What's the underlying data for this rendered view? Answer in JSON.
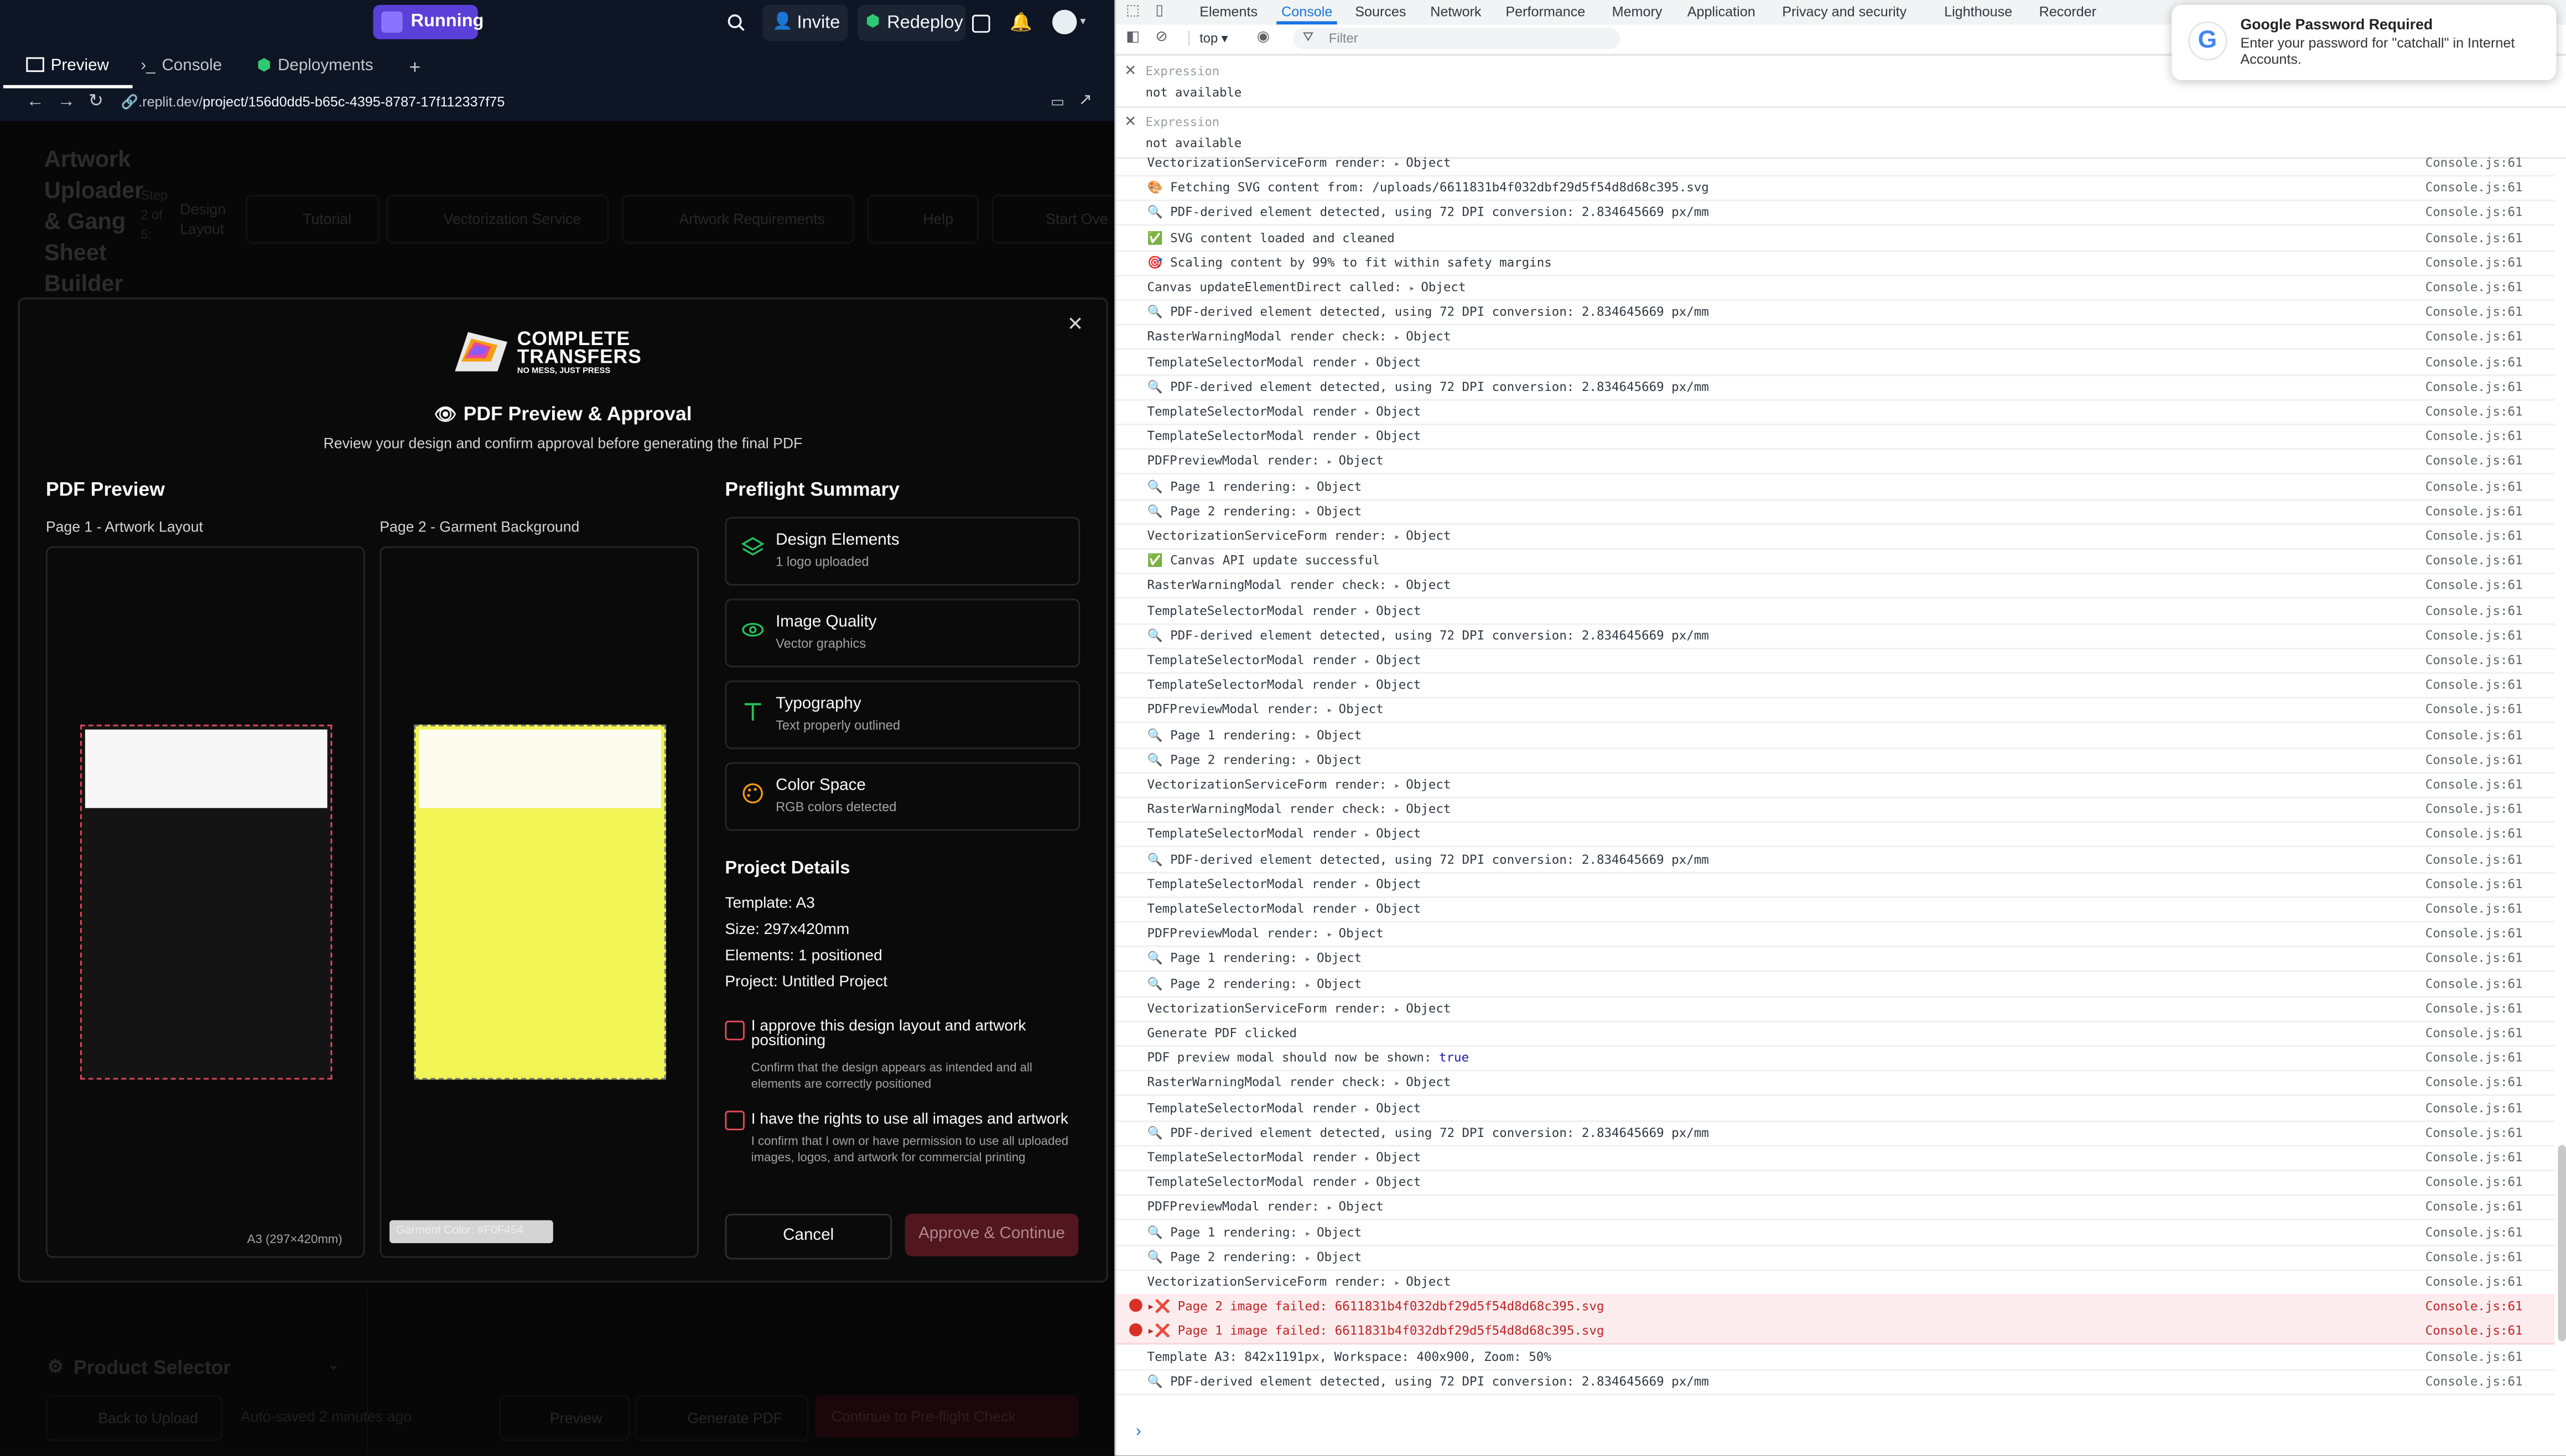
{
  "replit": {
    "status_label": "Running",
    "invite_label": "Invite",
    "redeploy_label": "Redeploy",
    "tabs": [
      {
        "label": "Preview"
      },
      {
        "label": "Console"
      },
      {
        "label": "Deployments"
      }
    ],
    "url_prefix": ".replit.dev/",
    "url_path": "project/156d0dd5-b65c-4395-8787-17f112337f75"
  },
  "app_bg": {
    "title": "Artwork Uploader & Gang Sheet Builder",
    "step": "Step 2 of 5:",
    "step_name": "Design Layout",
    "nav": [
      "Tutorial",
      "Vectorization Service",
      "Artwork Requirements",
      "Help",
      "Start Ove"
    ],
    "product_selector": "Product Selector",
    "back_label": "Back to Upload",
    "autosaved": "Auto-saved 2 minutes ago",
    "preview_label": "Preview",
    "generate_label": "Generate PDF",
    "continue_label": "Continue to Pre-flight Check"
  },
  "modal": {
    "brand_line1": "COMPLETE",
    "brand_line2": "TRANSFERS",
    "brand_tagline": "NO MESS, JUST PRESS",
    "title": "PDF Preview & Approval",
    "subtitle": "Review your design and confirm approval before generating the final PDF",
    "pdf_preview_heading": "PDF Preview",
    "page1_label": "Page 1 - Artwork Layout",
    "page2_label": "Page 2 - Garment Background",
    "page1_size": "A3 (297×420mm)",
    "page2_badge": "Garment Color: #F0F454",
    "preflight_heading": "Preflight Summary",
    "preflight_items": [
      {
        "title": "Design Elements",
        "sub": "1 logo uploaded",
        "icon": "layers-icon",
        "color": "#22c55e"
      },
      {
        "title": "Image Quality",
        "sub": "Vector graphics",
        "icon": "eye-icon",
        "color": "#22c55e"
      },
      {
        "title": "Typography",
        "sub": "Text properly outlined",
        "icon": "type-icon",
        "color": "#22c55e"
      },
      {
        "title": "Color Space",
        "sub": "RGB colors detected",
        "icon": "palette-icon",
        "color": "#f59e0b"
      }
    ],
    "project_heading": "Project Details",
    "project_lines": [
      "Template: A3",
      "Size: 297x420mm",
      "Elements: 1 positioned",
      "Project: Untitled Project"
    ],
    "approve1_title": "I approve this design layout and artwork positioning",
    "approve1_sub": "Confirm that the design appears as intended and all elements are correctly positioned",
    "approve2_title": "I have the rights to use all images and artwork",
    "approve2_sub": "I confirm that I own or have permission to use all uploaded images, logos, and artwork for commercial printing",
    "cancel_label": "Cancel",
    "approve_label": "Approve & Continue",
    "garment_color": "#F0F454"
  },
  "devtools": {
    "tabs": [
      "Elements",
      "Console",
      "Sources",
      "Network",
      "Performance",
      "Memory",
      "Application",
      "Privacy and security",
      "Lighthouse",
      "Recorder"
    ],
    "context": "top ▾",
    "filter_placeholder": "Filter",
    "expressions": [
      {
        "label": "Expression",
        "value": "not available"
      },
      {
        "label": "Expression",
        "value": "not available"
      }
    ],
    "logs": [
      {
        "icon": "",
        "msg": "VectorizationServiceForm render:",
        "obj": "Object",
        "src": "Console.js:61"
      },
      {
        "icon": "🎨",
        "msg": "Fetching SVG content from: /uploads/6611831b4f032dbf29d5f54d8d68c395.svg",
        "obj": "",
        "src": "Console.js:61"
      },
      {
        "icon": "🔍",
        "msg": "PDF-derived element detected, using 72 DPI conversion: 2.834645669 px/mm",
        "obj": "",
        "src": "Console.js:61"
      },
      {
        "icon": "✅",
        "msg": "SVG content loaded and cleaned",
        "obj": "",
        "src": "Console.js:61"
      },
      {
        "icon": "🎯",
        "msg": "Scaling content by 99% to fit within safety margins",
        "obj": "",
        "src": "Console.js:61"
      },
      {
        "icon": "",
        "msg": "Canvas updateElementDirect called:",
        "obj": "Object",
        "src": "Console.js:61"
      },
      {
        "icon": "🔍",
        "msg": "PDF-derived element detected, using 72 DPI conversion: 2.834645669 px/mm",
        "obj": "",
        "src": "Console.js:61"
      },
      {
        "icon": "",
        "msg": "RasterWarningModal render check:",
        "obj": "Object",
        "src": "Console.js:61"
      },
      {
        "icon": "",
        "msg": "TemplateSelectorModal render",
        "obj": "Object",
        "src": "Console.js:61"
      },
      {
        "icon": "🔍",
        "msg": "PDF-derived element detected, using 72 DPI conversion: 2.834645669 px/mm",
        "obj": "",
        "src": "Console.js:61"
      },
      {
        "icon": "",
        "msg": "TemplateSelectorModal render",
        "obj": "Object",
        "src": "Console.js:61"
      },
      {
        "icon": "",
        "msg": "TemplateSelectorModal render",
        "obj": "Object",
        "src": "Console.js:61"
      },
      {
        "icon": "",
        "msg": "PDFPreviewModal render:",
        "obj": "Object",
        "src": "Console.js:61"
      },
      {
        "icon": "🔍",
        "msg": "Page 1 rendering:",
        "obj": "Object",
        "src": "Console.js:61"
      },
      {
        "icon": "🔍",
        "msg": "Page 2 rendering:",
        "obj": "Object",
        "src": "Console.js:61"
      },
      {
        "icon": "",
        "msg": "VectorizationServiceForm render:",
        "obj": "Object",
        "src": "Console.js:61"
      },
      {
        "icon": "✅",
        "msg": "Canvas API update successful",
        "obj": "",
        "src": "Console.js:61"
      },
      {
        "icon": "",
        "msg": "RasterWarningModal render check:",
        "obj": "Object",
        "src": "Console.js:61"
      },
      {
        "icon": "",
        "msg": "TemplateSelectorModal render",
        "obj": "Object",
        "src": "Console.js:61"
      },
      {
        "icon": "🔍",
        "msg": "PDF-derived element detected, using 72 DPI conversion: 2.834645669 px/mm",
        "obj": "",
        "src": "Console.js:61"
      },
      {
        "icon": "",
        "msg": "TemplateSelectorModal render",
        "obj": "Object",
        "src": "Console.js:61"
      },
      {
        "icon": "",
        "msg": "TemplateSelectorModal render",
        "obj": "Object",
        "src": "Console.js:61"
      },
      {
        "icon": "",
        "msg": "PDFPreviewModal render:",
        "obj": "Object",
        "src": "Console.js:61"
      },
      {
        "icon": "🔍",
        "msg": "Page 1 rendering:",
        "obj": "Object",
        "src": "Console.js:61"
      },
      {
        "icon": "🔍",
        "msg": "Page 2 rendering:",
        "obj": "Object",
        "src": "Console.js:61"
      },
      {
        "icon": "",
        "msg": "VectorizationServiceForm render:",
        "obj": "Object",
        "src": "Console.js:61"
      },
      {
        "icon": "",
        "msg": "RasterWarningModal render check:",
        "obj": "Object",
        "src": "Console.js:61"
      },
      {
        "icon": "",
        "msg": "TemplateSelectorModal render",
        "obj": "Object",
        "src": "Console.js:61"
      },
      {
        "icon": "🔍",
        "msg": "PDF-derived element detected, using 72 DPI conversion: 2.834645669 px/mm",
        "obj": "",
        "src": "Console.js:61"
      },
      {
        "icon": "",
        "msg": "TemplateSelectorModal render",
        "obj": "Object",
        "src": "Console.js:61"
      },
      {
        "icon": "",
        "msg": "TemplateSelectorModal render",
        "obj": "Object",
        "src": "Console.js:61"
      },
      {
        "icon": "",
        "msg": "PDFPreviewModal render:",
        "obj": "Object",
        "src": "Console.js:61"
      },
      {
        "icon": "🔍",
        "msg": "Page 1 rendering:",
        "obj": "Object",
        "src": "Console.js:61"
      },
      {
        "icon": "🔍",
        "msg": "Page 2 rendering:",
        "obj": "Object",
        "src": "Console.js:61"
      },
      {
        "icon": "",
        "msg": "VectorizationServiceForm render:",
        "obj": "Object",
        "src": "Console.js:61"
      },
      {
        "icon": "",
        "msg": "Generate PDF clicked",
        "obj": "",
        "src": "Console.js:61"
      },
      {
        "icon": "",
        "msg": "PDF preview modal should now be shown:",
        "obj": "",
        "bool": "true",
        "src": "Console.js:61"
      },
      {
        "icon": "",
        "msg": "RasterWarningModal render check:",
        "obj": "Object",
        "src": "Console.js:61"
      },
      {
        "icon": "",
        "msg": "TemplateSelectorModal render",
        "obj": "Object",
        "src": "Console.js:61"
      },
      {
        "icon": "🔍",
        "msg": "PDF-derived element detected, using 72 DPI conversion: 2.834645669 px/mm",
        "obj": "",
        "src": "Console.js:61"
      },
      {
        "icon": "",
        "msg": "TemplateSelectorModal render",
        "obj": "Object",
        "src": "Console.js:61"
      },
      {
        "icon": "",
        "msg": "TemplateSelectorModal render",
        "obj": "Object",
        "src": "Console.js:61"
      },
      {
        "icon": "",
        "msg": "PDFPreviewModal render:",
        "obj": "Object",
        "src": "Console.js:61"
      },
      {
        "icon": "🔍",
        "msg": "Page 1 rendering:",
        "obj": "Object",
        "src": "Console.js:61"
      },
      {
        "icon": "🔍",
        "msg": "Page 2 rendering:",
        "obj": "Object",
        "src": "Console.js:61"
      },
      {
        "icon": "",
        "msg": "VectorizationServiceForm render:",
        "obj": "Object",
        "src": "Console.js:61"
      },
      {
        "icon": "▸❌",
        "msg": "Page 2 image failed: 6611831b4f032dbf29d5f54d8d68c395.svg",
        "obj": "",
        "src": "Console.js:61",
        "error": true
      },
      {
        "icon": "▸❌",
        "msg": "Page 1 image failed: 6611831b4f032dbf29d5f54d8d68c395.svg",
        "obj": "",
        "src": "Console.js:61",
        "error": true
      },
      {
        "icon": "",
        "msg": "Template A3: 842x1191px, Workspace: 400x900, Zoom: 50%",
        "obj": "",
        "src": "Console.js:61"
      },
      {
        "icon": "🔍",
        "msg": "PDF-derived element detected, using 72 DPI conversion: 2.834645669 px/mm",
        "obj": "",
        "src": "Console.js:61"
      }
    ],
    "prompt": "›"
  },
  "notification": {
    "title": "Google Password Required",
    "body": "Enter your password for \"catchall\" in Internet Accounts."
  }
}
